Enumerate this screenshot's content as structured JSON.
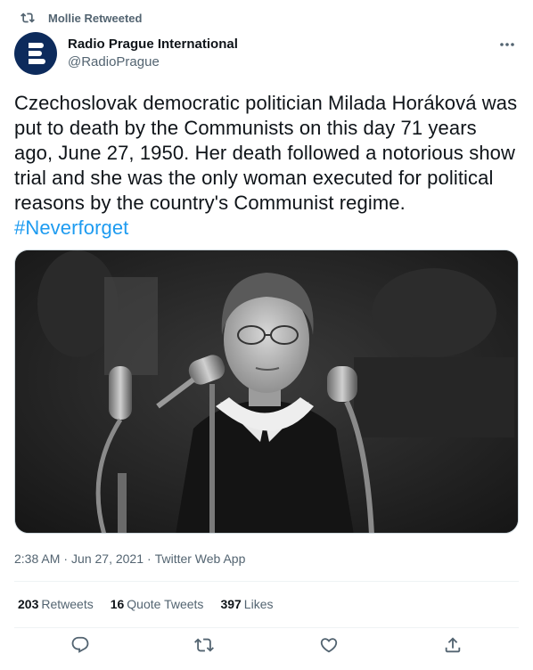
{
  "social_context": {
    "text": "Mollie Retweeted",
    "icon": "retweet-icon"
  },
  "author": {
    "display_name": "Radio Prague International",
    "handle": "@RadioPrague",
    "avatar_color": "#0d2b5c"
  },
  "tweet": {
    "text": "Czechoslovak democratic politician Milada Horáková was put to death by the Communists on this day 71 years ago, June 27, 1950. Her death followed a notorious show trial and she was the only woman executed for political reasons by the country's Communist regime.",
    "hashtag": "#Neverforget"
  },
  "media": {
    "description_icon": "photo"
  },
  "meta": {
    "time": "2:38 AM",
    "separator1": "·",
    "date": "Jun 27, 2021",
    "separator2": "·",
    "source": "Twitter Web App"
  },
  "stats": {
    "retweets_count": "203",
    "retweets_label": "Retweets",
    "quotes_count": "16",
    "quotes_label": "Quote Tweets",
    "likes_count": "397",
    "likes_label": "Likes"
  },
  "actions": [
    "reply-icon",
    "retweet-icon",
    "like-icon",
    "share-icon"
  ],
  "colors": {
    "accent": "#1d9bf0",
    "secondary_text": "#536471",
    "primary_text": "#0f1419"
  }
}
